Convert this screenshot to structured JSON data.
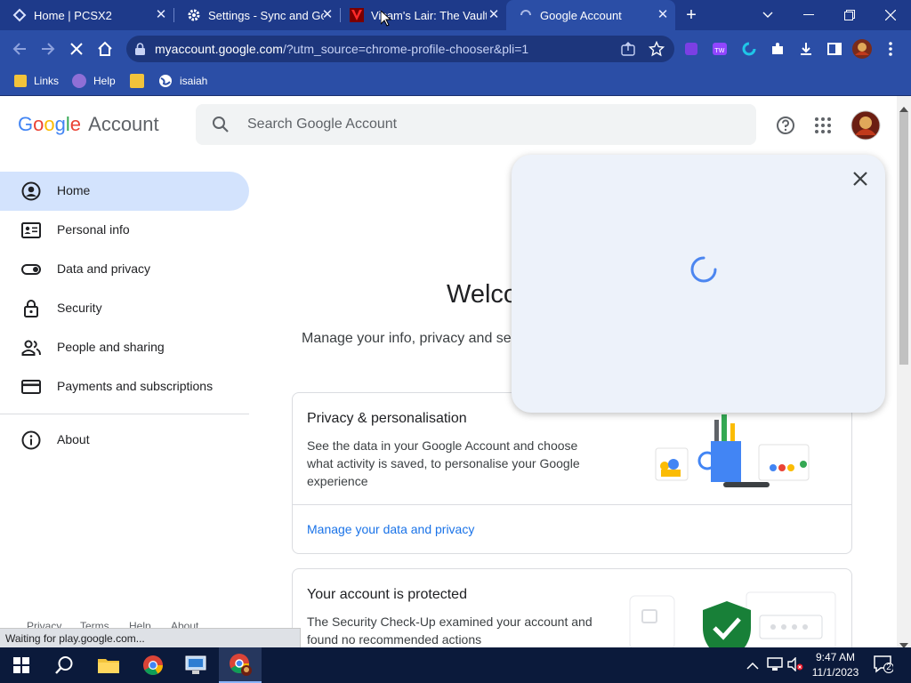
{
  "browser": {
    "tabs": [
      {
        "title": "Home | PCSX2",
        "active": false
      },
      {
        "title": "Settings - Sync and Go",
        "active": false
      },
      {
        "title": "Vicam's Lair: The Vault",
        "active": false
      },
      {
        "title": "Google Account",
        "active": true
      }
    ],
    "new_tab": "+",
    "url_host": "myaccount.google.com",
    "url_rest": "/?utm_source=chrome-profile-chooser&pli=1",
    "bookmarks": [
      "Links",
      "Help",
      "isaiah"
    ],
    "status": "Waiting for play.google.com..."
  },
  "header": {
    "logo_google": "Google",
    "logo_account": "Account",
    "search_placeholder": "Search Google Account"
  },
  "sidebar": {
    "items": [
      {
        "label": "Home",
        "icon": "account-circle-icon",
        "active": true
      },
      {
        "label": "Personal info",
        "icon": "id-card-icon"
      },
      {
        "label": "Data and privacy",
        "icon": "toggle-icon"
      },
      {
        "label": "Security",
        "icon": "lock-icon"
      },
      {
        "label": "People and sharing",
        "icon": "people-icon"
      },
      {
        "label": "Payments and subscriptions",
        "icon": "credit-card-icon"
      },
      {
        "label": "About",
        "icon": "info-icon"
      }
    ],
    "footer": [
      "Privacy",
      "Terms",
      "Help",
      "About"
    ]
  },
  "main": {
    "welcome": "Welco",
    "subtitle": "Manage your info, privacy and se",
    "cards": [
      {
        "title": "Privacy & personalisation",
        "desc": "See the data in your Google Account and choose what activity is saved, to personalise your Google experience",
        "link": "Manage your data and privacy"
      },
      {
        "title": "Your account is protected",
        "desc": "The Security Check-Up examined your account and found no recommended actions"
      }
    ]
  },
  "taskbar": {
    "time": "9:47 AM",
    "date": "11/1/2023",
    "notif_count": "2"
  },
  "colors": {
    "accent": "#1a73e8",
    "tabbar": "#1e3a8a",
    "active_nav": "#d3e3fd"
  }
}
